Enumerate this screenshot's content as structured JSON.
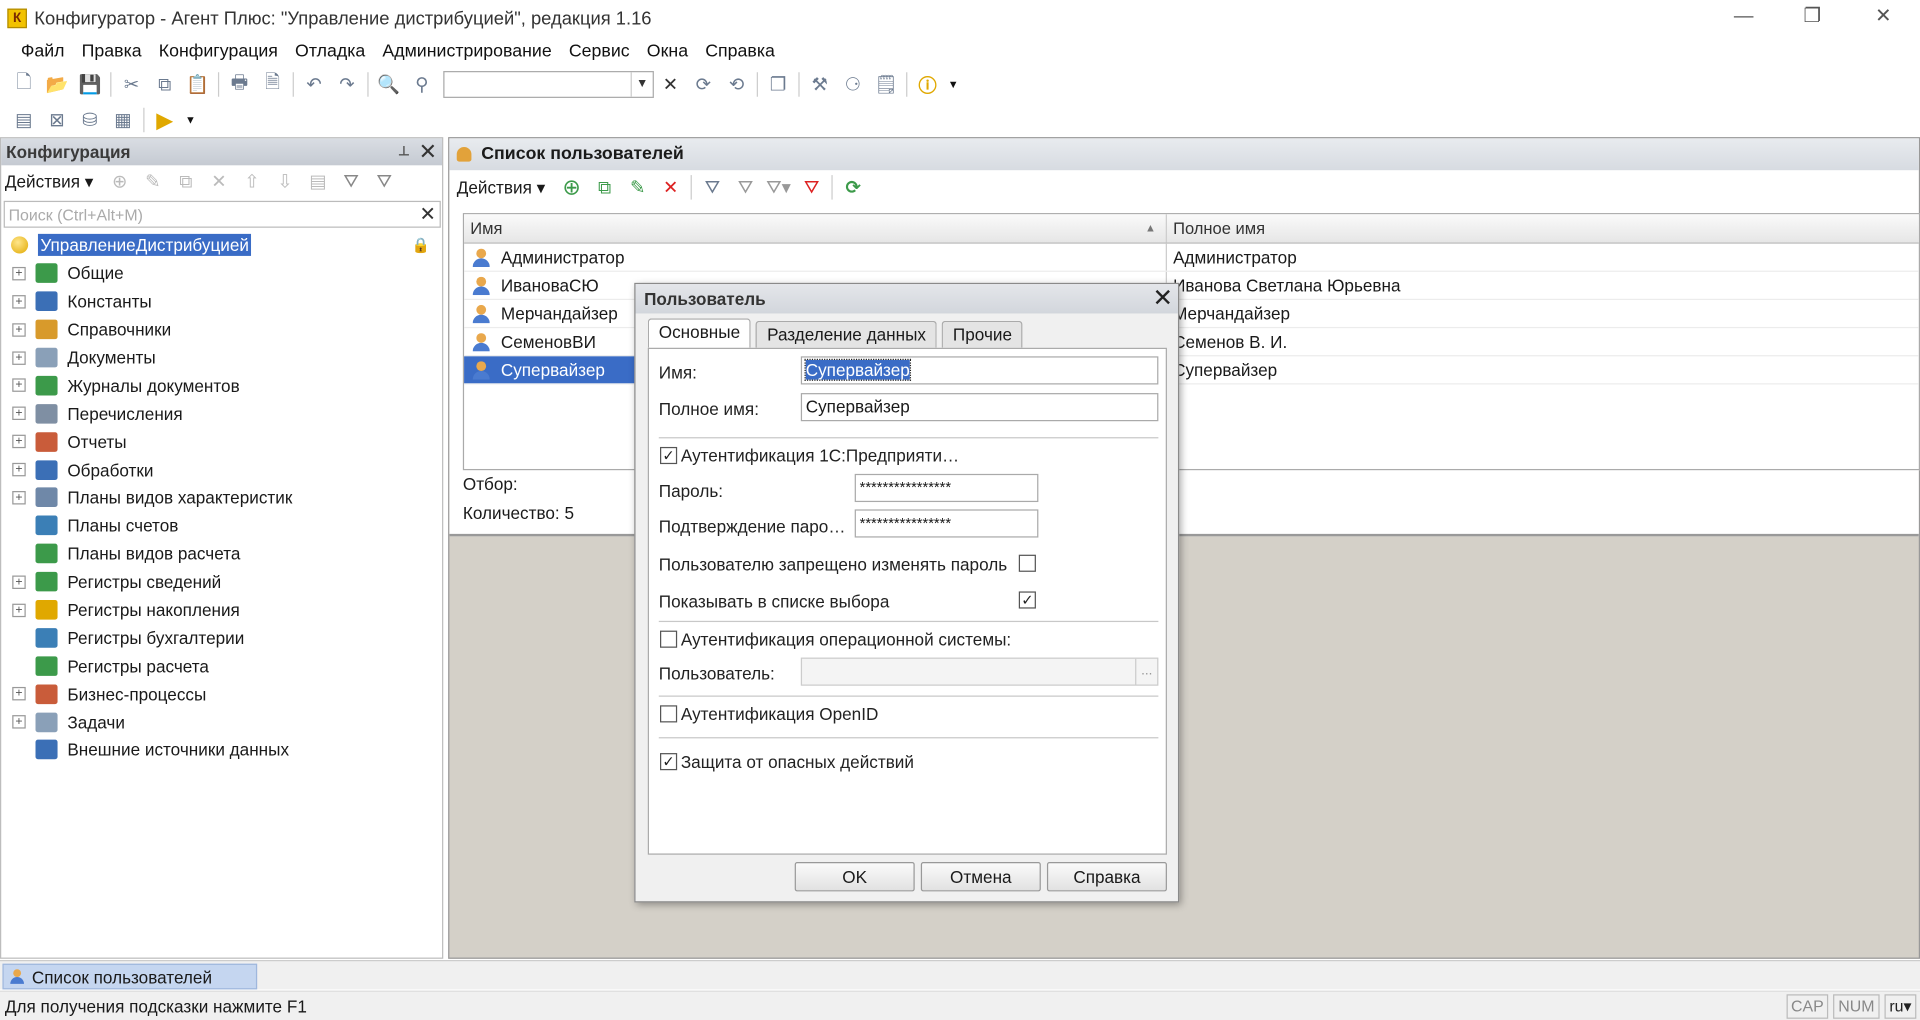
{
  "window": {
    "title": "Конфигуратор - Агент Плюс: \"Управление дистрибуцией\", редакция 1.16",
    "minimize_icon": "—",
    "restore_icon": "❐",
    "close_icon": "✕"
  },
  "menu": [
    "Файл",
    "Правка",
    "Конфигурация",
    "Отладка",
    "Администрирование",
    "Сервис",
    "Окна",
    "Справка"
  ],
  "left_panel": {
    "title": "Конфигурация",
    "actions_label": "Действия",
    "search_placeholder": "Поиск (Ctrl+Alt+M)",
    "root": "УправлениеДистрибуцией",
    "items": [
      {
        "label": "Общие",
        "expand": true,
        "color": "#3c9a4a"
      },
      {
        "label": "Константы",
        "expand": true,
        "color": "#3b6fb6"
      },
      {
        "label": "Справочники",
        "expand": true,
        "color": "#d89a2b"
      },
      {
        "label": "Документы",
        "expand": true,
        "color": "#8aa0b8"
      },
      {
        "label": "Журналы документов",
        "expand": true,
        "color": "#3c9a4a"
      },
      {
        "label": "Перечисления",
        "expand": true,
        "color": "#7f8fa3"
      },
      {
        "label": "Отчеты",
        "expand": true,
        "color": "#c95c3a"
      },
      {
        "label": "Обработки",
        "expand": true,
        "color": "#3b6fb6"
      },
      {
        "label": "Планы видов характеристик",
        "expand": true,
        "color": "#6f88a8"
      },
      {
        "label": "Планы счетов",
        "expand": false,
        "color": "#3b7fb6"
      },
      {
        "label": "Планы видов расчета",
        "expand": false,
        "color": "#3c9a4a"
      },
      {
        "label": "Регистры сведений",
        "expand": true,
        "color": "#3c9a4a"
      },
      {
        "label": "Регистры накопления",
        "expand": true,
        "color": "#e0a800"
      },
      {
        "label": "Регистры бухгалтерии",
        "expand": false,
        "color": "#3b7fb6"
      },
      {
        "label": "Регистры расчета",
        "expand": false,
        "color": "#3c9a4a"
      },
      {
        "label": "Бизнес-процессы",
        "expand": true,
        "color": "#c95c3a"
      },
      {
        "label": "Задачи",
        "expand": true,
        "color": "#8aa0b8"
      },
      {
        "label": "Внешние источники данных",
        "expand": false,
        "color": "#3b6fb6"
      }
    ]
  },
  "users_list": {
    "title": "Список пользователей",
    "actions_label": "Действия",
    "col_name": "Имя",
    "col_fullname": "Полное имя",
    "rows": [
      {
        "name": "Администратор",
        "full": "Администратор"
      },
      {
        "name": "ИвановаСЮ",
        "full": "Иванова Светлана Юрьевна"
      },
      {
        "name": "Мерчандайзер",
        "full": "Мерчандайзер"
      },
      {
        "name": "СеменовВИ",
        "full": "Семенов В. И."
      },
      {
        "name": "Супервайзер",
        "full": "Супервайзер"
      }
    ],
    "filter_label": "Отбор:",
    "count_label": "Количество: 5"
  },
  "dialog": {
    "title": "Пользователь",
    "tabs": [
      "Основные",
      "Разделение данных",
      "Прочие"
    ],
    "name_label": "Имя:",
    "name_value": "Супервайзер",
    "fullname_label": "Полное имя:",
    "fullname_value": "Супервайзер",
    "auth_1c_label": "Аутентификация 1С:Предприяти…",
    "password_label": "Пароль:",
    "password_value": "****************",
    "confirm_label": "Подтверждение паро…",
    "confirm_value": "****************",
    "forbid_change_label": "Пользователю запрещено изменять пароль",
    "show_in_list_label": "Показывать в списке выбора",
    "auth_os_label": "Аутентификация операционной системы:",
    "os_user_label": "Пользователь:",
    "os_user_btn": "...",
    "auth_openid_label": "Аутентификация OpenID",
    "danger_label": "Защита от опасных действий",
    "ok": "OK",
    "cancel": "Отмена",
    "help": "Справка",
    "checks": {
      "auth_1c": true,
      "forbid": false,
      "show": true,
      "os": false,
      "openid": false,
      "danger": true
    }
  },
  "taskbar": {
    "item": "Список пользователей"
  },
  "status": {
    "hint": "Для получения подсказки нажмите F1",
    "cap": "CAP",
    "num": "NUM",
    "lang": "ru"
  }
}
